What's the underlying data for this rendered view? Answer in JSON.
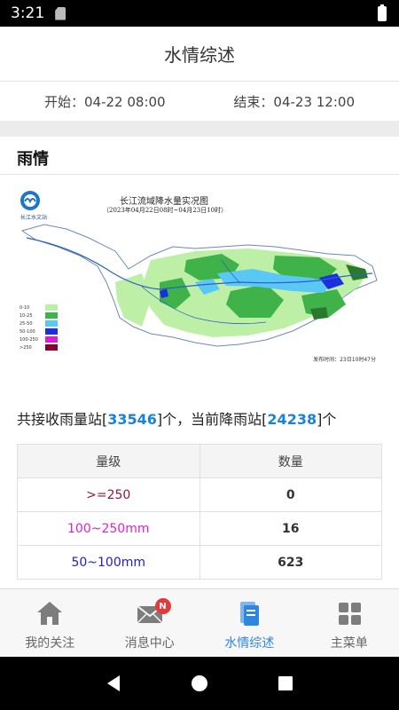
{
  "status": {
    "time": "3:21"
  },
  "header": {
    "title": "水情综述"
  },
  "date_range": {
    "start_label": "开始：04-22 08:00",
    "end_label": "结束：04-23 12:00"
  },
  "rain": {
    "section_title": "雨情",
    "map": {
      "title": "长江流域降水量实况图",
      "subtitle": "（2023年04月22日08时~04月23日10时）",
      "org": "长江水文站",
      "time_note": "发布时间：23日10时47分",
      "legend": [
        {
          "label": "0-10",
          "color": "#bdf0a6"
        },
        {
          "label": "10-25",
          "color": "#3fb24a"
        },
        {
          "label": "25-50",
          "color": "#5ac8f5"
        },
        {
          "label": "50-100",
          "color": "#1b2fe0"
        },
        {
          "label": "100-250",
          "color": "#e01bd8"
        },
        {
          "label": ">250",
          "color": "#880030"
        }
      ]
    },
    "summary": {
      "prefix": "共接收雨量站[",
      "total": "33546",
      "middle": "]个，当前降雨站[",
      "raining": "24238",
      "suffix": "]个"
    },
    "table": {
      "headers": [
        "量级",
        "数量"
      ],
      "rows": [
        {
          "level": ">=250",
          "count": "0",
          "color": "#8b1a3a"
        },
        {
          "level": "100~250mm",
          "count": "16",
          "color": "#e020d0"
        },
        {
          "level": "50~100mm",
          "count": "623",
          "color": "#2020c8"
        }
      ]
    }
  },
  "tabbar": {
    "items": [
      {
        "label": "我的关注",
        "icon": "home-icon"
      },
      {
        "label": "消息中心",
        "icon": "mail-icon",
        "badge": "N"
      },
      {
        "label": "水情综述",
        "icon": "document-icon",
        "active": true
      },
      {
        "label": "主菜单",
        "icon": "grid-icon"
      }
    ]
  }
}
